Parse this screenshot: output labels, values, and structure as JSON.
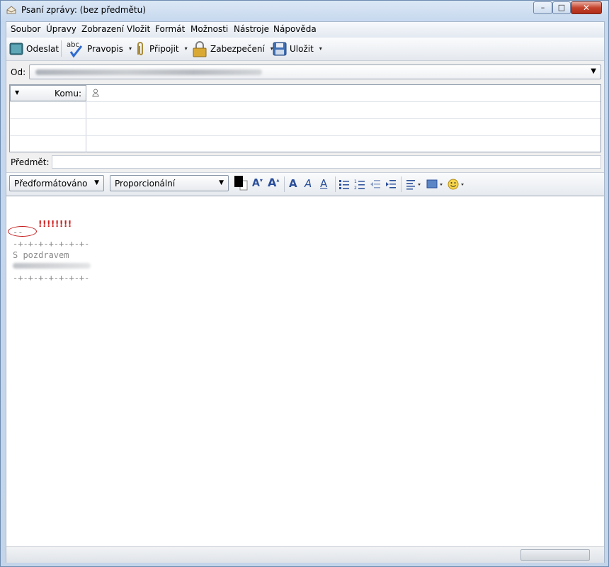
{
  "window": {
    "title": "Psaní zprávy: (bez předmětu)",
    "min_glyph": "–",
    "max_glyph": "□",
    "close_glyph": "✕"
  },
  "menu": [
    "Soubor",
    "Úpravy",
    "Zobrazení",
    "Vložit",
    "Formát",
    "Možnosti",
    "Nástroje",
    "Nápověda"
  ],
  "toolbar": {
    "send": "Odeslat",
    "spell": "Pravopis",
    "spell_icon_text": "abc",
    "attach": "Připojit",
    "security": "Zabezpečení",
    "save": "Uložit",
    "arrow": "▾"
  },
  "header": {
    "from_label": "Od:",
    "to_label": "Komu:",
    "subject_label": "Předmět:",
    "subject_value": ""
  },
  "format": {
    "paragraph": "Předformátováno",
    "font": "Proporcionální"
  },
  "body": {
    "annotation": "!!!!!!!!",
    "sig_dash": "--",
    "sig_line1": "-+-+-+-+-+-+-+-",
    "greeting": "S pozdravem",
    "sig_line2": "-+-+-+-+-+-+-+-"
  },
  "colors": {
    "accent": "#2a4e9a",
    "annotation": "#d01c1c"
  }
}
